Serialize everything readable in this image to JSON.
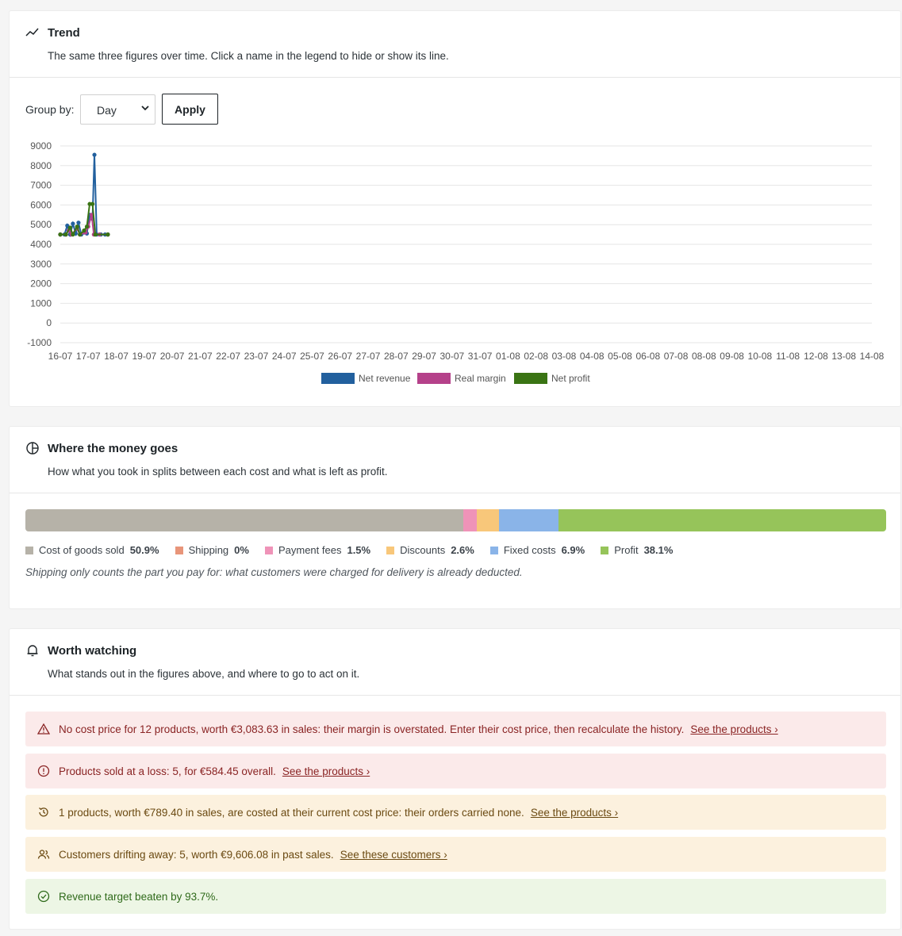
{
  "trend": {
    "title": "Trend",
    "subtitle": "The same three figures over time. Click a name in the legend to hide or show its line.",
    "group_by_label": "Group by:",
    "group_by_value": "Day",
    "apply_label": "Apply"
  },
  "chart_data": {
    "type": "line",
    "x": [
      "16-07",
      "17-07",
      "18-07",
      "19-07",
      "20-07",
      "21-07",
      "22-07",
      "23-07",
      "24-07",
      "25-07",
      "26-07",
      "27-07",
      "28-07",
      "29-07",
      "30-07",
      "31-07",
      "01-08",
      "02-08",
      "03-08",
      "04-08",
      "05-08",
      "06-08",
      "07-08",
      "08-08",
      "09-08",
      "10-08",
      "11-08",
      "12-08",
      "13-08",
      "14-08"
    ],
    "y_ticks": [
      "9000",
      "8000",
      "7000",
      "6000",
      "5000",
      "4000",
      "3000",
      "2000",
      "1000",
      "0",
      "-1000"
    ],
    "ylim": [
      -1000,
      9000
    ],
    "grid": true,
    "legend_position": "bottom",
    "series": [
      {
        "name": "Net revenue",
        "color": "#22609e",
        "points": [
          [
            0,
            4500
          ],
          [
            0.15,
            4500
          ],
          [
            0.25,
            4950
          ],
          [
            0.35,
            4500
          ],
          [
            0.45,
            5050
          ],
          [
            0.55,
            4550
          ],
          [
            0.65,
            5100
          ],
          [
            0.75,
            4500
          ],
          [
            0.85,
            4600
          ],
          [
            0.95,
            4550
          ],
          [
            1.05,
            5500
          ],
          [
            1.15,
            5300
          ],
          [
            1.22,
            8550
          ],
          [
            1.3,
            4500
          ],
          [
            1.45,
            4500
          ],
          [
            1.6,
            4500
          ],
          [
            1.7,
            4500
          ]
        ]
      },
      {
        "name": "Real margin",
        "color": "#b5418a",
        "points": [
          [
            0,
            4500
          ],
          [
            0.2,
            4500
          ],
          [
            0.3,
            4700
          ],
          [
            0.4,
            4500
          ],
          [
            0.6,
            4800
          ],
          [
            0.7,
            4500
          ],
          [
            0.9,
            4600
          ],
          [
            1.0,
            4900
          ],
          [
            1.12,
            5500
          ],
          [
            1.2,
            4500
          ],
          [
            1.4,
            4500
          ],
          [
            1.7,
            4500
          ]
        ]
      },
      {
        "name": "Net profit",
        "color": "#3a7414",
        "points": [
          [
            0,
            4500
          ],
          [
            0.2,
            4500
          ],
          [
            0.35,
            4850
          ],
          [
            0.45,
            4500
          ],
          [
            0.6,
            4900
          ],
          [
            0.7,
            4500
          ],
          [
            0.85,
            4700
          ],
          [
            0.95,
            4900
          ],
          [
            1.05,
            6050
          ],
          [
            1.15,
            6050
          ],
          [
            1.25,
            4500
          ],
          [
            1.7,
            4500
          ]
        ]
      }
    ]
  },
  "money": {
    "title": "Where the money goes",
    "subtitle": "How what you took in splits between each cost and what is left as profit.",
    "segments": [
      {
        "label": "Cost of goods sold",
        "pct_text": "50.9%",
        "value": 50.9,
        "color": "#b6b2a8"
      },
      {
        "label": "Shipping",
        "pct_text": "0%",
        "value": 0,
        "color": "#e8957a"
      },
      {
        "label": "Payment fees",
        "pct_text": "1.5%",
        "value": 1.5,
        "color": "#ef93b8"
      },
      {
        "label": "Discounts",
        "pct_text": "2.6%",
        "value": 2.6,
        "color": "#f8c77a"
      },
      {
        "label": "Fixed costs",
        "pct_text": "6.9%",
        "value": 6.9,
        "color": "#8ab4e8"
      },
      {
        "label": "Profit",
        "pct_text": "38.1%",
        "value": 38.1,
        "color": "#96c45a"
      }
    ],
    "note": "Shipping only counts the part you pay for: what customers were charged for delivery is already deducted."
  },
  "watching": {
    "title": "Worth watching",
    "subtitle": "What stands out in the figures above, and where to go to act on it.",
    "alerts": [
      {
        "text": "No cost price for 12 products, worth €3,083.63 in sales: their margin is overstated. Enter their cost price, then recalculate the history.",
        "link": "See the products ›",
        "icon": "warning-triangle-icon",
        "tone": "red"
      },
      {
        "text": "Products sold at a loss: 5, for €584.45 overall.",
        "link": "See the products ›",
        "icon": "alert-circle-icon",
        "tone": "red"
      },
      {
        "text": "1 products, worth €789.40 in sales, are costed at their current cost price: their orders carried none.",
        "link": "See the products ›",
        "icon": "history-icon",
        "tone": "amber"
      },
      {
        "text": "Customers drifting away: 5, worth €9,606.08 in past sales.",
        "link": "See these customers ›",
        "icon": "users-icon",
        "tone": "amber"
      },
      {
        "text": "Revenue target beaten by 93.7%.",
        "link": "",
        "icon": "check-circle-icon",
        "tone": "green"
      }
    ]
  }
}
